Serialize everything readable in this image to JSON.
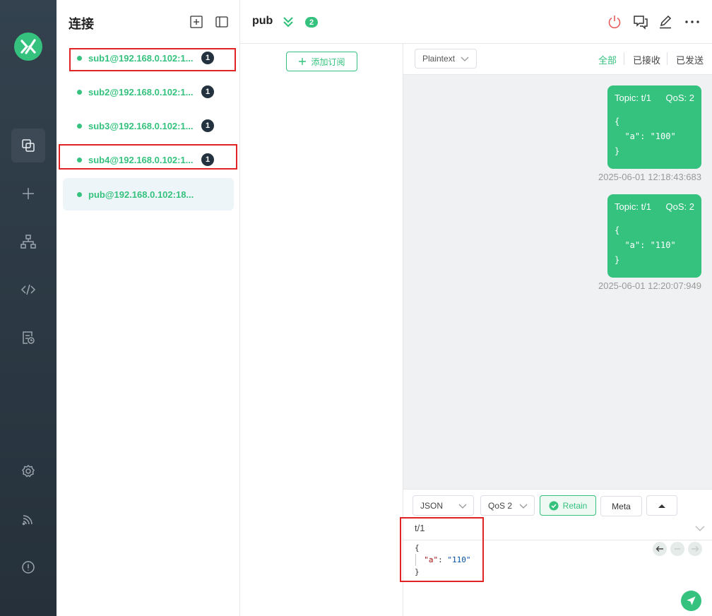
{
  "sidebar_rail": {
    "items": [
      {
        "name": "connections-nav",
        "icon": "connections-icon",
        "active": true
      },
      {
        "name": "new-connection-nav",
        "icon": "plus-icon"
      },
      {
        "name": "topology-nav",
        "icon": "sitemap-icon"
      },
      {
        "name": "script-nav",
        "icon": "code-icon"
      },
      {
        "name": "log-nav",
        "icon": "log-icon"
      },
      {
        "name": "settings-nav",
        "icon": "gear-icon"
      },
      {
        "name": "feed-nav",
        "icon": "rss-icon"
      },
      {
        "name": "about-nav",
        "icon": "info-icon"
      }
    ]
  },
  "connections": {
    "title": "连接",
    "items": [
      {
        "label": "sub1@192.168.0.102:1...",
        "badge": "1",
        "active": false
      },
      {
        "label": "sub2@192.168.0.102:1...",
        "badge": "1",
        "active": false
      },
      {
        "label": "sub3@192.168.0.102:1...",
        "badge": "1",
        "active": false
      },
      {
        "label": "sub4@192.168.0.102:1...",
        "badge": "1",
        "active": false
      },
      {
        "label": "pub@192.168.0.102:18...",
        "badge": "",
        "active": true
      }
    ]
  },
  "topbar": {
    "title": "pub",
    "count": "2"
  },
  "subscriptions": {
    "add_label": "添加订阅"
  },
  "messages": {
    "format": "Plaintext",
    "filters": [
      "全部",
      "已接收",
      "已发送"
    ],
    "items": [
      {
        "topic": "Topic: t/1",
        "qos": "QoS: 2",
        "payload": "{\n  \"a\": \"100\"\n}",
        "time": "2025-06-01 12:18:43:683"
      },
      {
        "topic": "Topic: t/1",
        "qos": "QoS: 2",
        "payload": "{\n  \"a\": \"110\"\n}",
        "time": "2025-06-01 12:20:07:949"
      }
    ]
  },
  "composer": {
    "format": "JSON",
    "qos": "QoS 2",
    "retain_label": "Retain",
    "meta_label": "Meta",
    "topic": "t/1",
    "payload_open": "{",
    "payload_key": "\"a\"",
    "payload_colon": ": ",
    "payload_value": "\"110\"",
    "payload_close": "}"
  },
  "colors": {
    "accent": "#35c27e",
    "rail": "#2c3944",
    "highlight": "#e02424"
  }
}
